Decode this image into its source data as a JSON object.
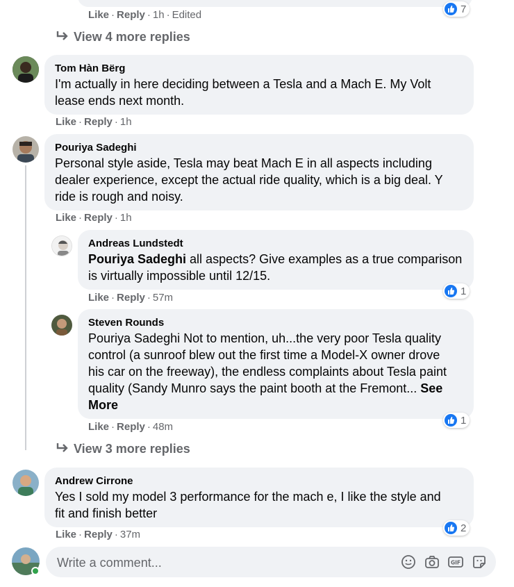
{
  "colors": {
    "bubble": "#f0f2f5",
    "meta": "#65676b",
    "like_blue": "#1877f2",
    "text": "#050505"
  },
  "top_comment": {
    "like": "Like",
    "reply": "Reply",
    "time": "1h",
    "edited": "Edited",
    "reaction_count": "7"
  },
  "view_more_1": "View 4 more replies",
  "view_more_2": "View 3 more replies",
  "comments": [
    {
      "author": "Tom Hàn Bërg",
      "lines": [
        "I'm actually in here deciding between a Tesla and a Mach E. My Volt",
        "lease ends next month."
      ],
      "like": "Like",
      "reply": "Reply",
      "time": "1h"
    },
    {
      "author": "Pouriya Sadeghi",
      "lines": [
        "Personal style aside, Tesla may beat Mach E in all aspects including",
        "dealer experience, except the actual ride quality, which is a big deal. Y",
        "ride is rough and noisy."
      ],
      "like": "Like",
      "reply": "Reply",
      "time": "1h"
    },
    {
      "author": "Andrew Cirrone",
      "lines": [
        "Yes I sold my model 3 performance for the mach e, I like the style and",
        "fit and finish better"
      ],
      "like": "Like",
      "reply": "Reply",
      "time": "37m",
      "reaction_count": "2"
    }
  ],
  "replies": [
    {
      "author": "Andreas Lundstedt",
      "mention": "Pouriya Sadeghi",
      "line1_rest": " all aspects? Give examples as a true comparison",
      "line2": "is virtually impossible until 12/15.",
      "like": "Like",
      "reply": "Reply",
      "time": "57m",
      "reaction_count": "1"
    },
    {
      "author": "Steven Rounds",
      "lines": [
        "Pouriya Sadeghi Not to mention, uh...the very poor Tesla quality",
        "control (a sunroof blew out the first time a Model-X owner drove",
        "his car on the freeway), the endless complaints about Tesla paint",
        "quality (Sandy Munro says the paint booth at the Fremont..."
      ],
      "see": "See",
      "more": "More",
      "like": "Like",
      "reply": "Reply",
      "time": "48m",
      "reaction_count": "1"
    }
  ],
  "composer": {
    "placeholder": "Write a comment...",
    "icons": [
      "emoji-icon",
      "camera-icon",
      "gif-icon",
      "sticker-icon"
    ]
  }
}
